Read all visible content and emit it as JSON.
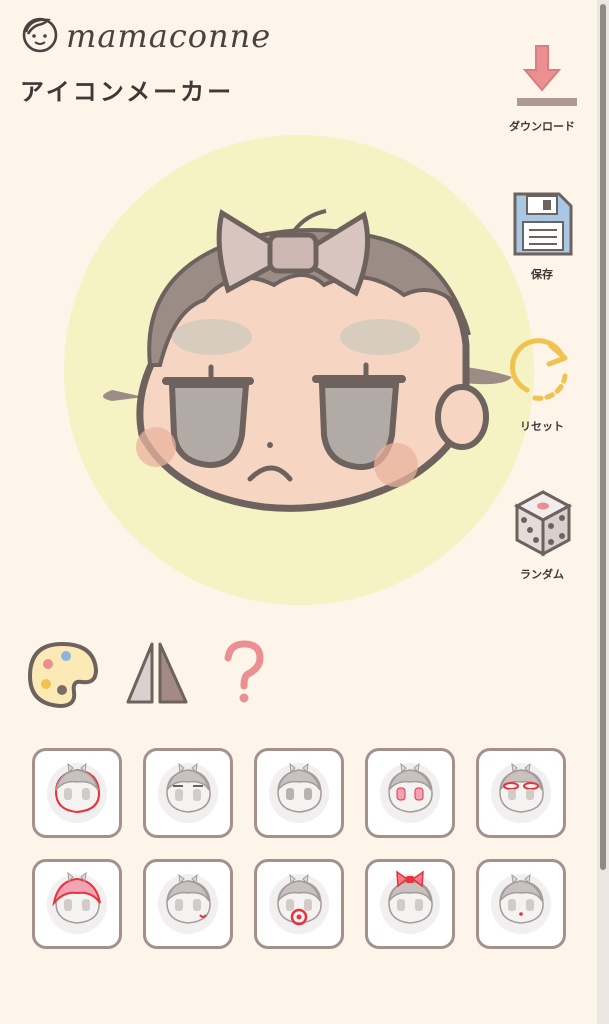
{
  "app": {
    "logo_text": "mamaconne",
    "title": "アイコンメーカー"
  },
  "side_tools": [
    {
      "id": "download",
      "label": "ダウンロード",
      "icon": "download-arrow-icon"
    },
    {
      "id": "save",
      "label": "保存",
      "icon": "floppy-disk-icon"
    },
    {
      "id": "reset",
      "label": "リセット",
      "icon": "reset-arrow-icon"
    },
    {
      "id": "random",
      "label": "ランダム",
      "icon": "dice-icon"
    }
  ],
  "tools": [
    {
      "id": "palette",
      "icon": "palette-icon"
    },
    {
      "id": "flip",
      "icon": "flip-icon"
    },
    {
      "id": "help",
      "icon": "question-mark-icon"
    }
  ],
  "part_tiles": [
    {
      "icon": "face-outline-icon",
      "highlight": "face-outline"
    },
    {
      "icon": "eyebrows-icon",
      "highlight": "eyebrows"
    },
    {
      "icon": "eyes-icon",
      "highlight": "eyes"
    },
    {
      "icon": "eye-color-icon",
      "highlight": "eye-color"
    },
    {
      "icon": "eye-lashes-icon",
      "highlight": "eye-lashes"
    },
    {
      "icon": "hair-icon",
      "highlight": "hair"
    },
    {
      "icon": "mouth-icon",
      "highlight": "mouth"
    },
    {
      "icon": "pacifier-icon",
      "highlight": "pacifier"
    },
    {
      "icon": "ribbon-icon",
      "highlight": "ribbon"
    },
    {
      "icon": "nose-icon",
      "highlight": "nose"
    }
  ],
  "colors": {
    "background": "#fdf4ea",
    "canvas_bg": "#f5f2c3",
    "accent_pink": "#ec8f92",
    "tile_border": "#a4918c",
    "highlight_red": "#e8323c"
  }
}
